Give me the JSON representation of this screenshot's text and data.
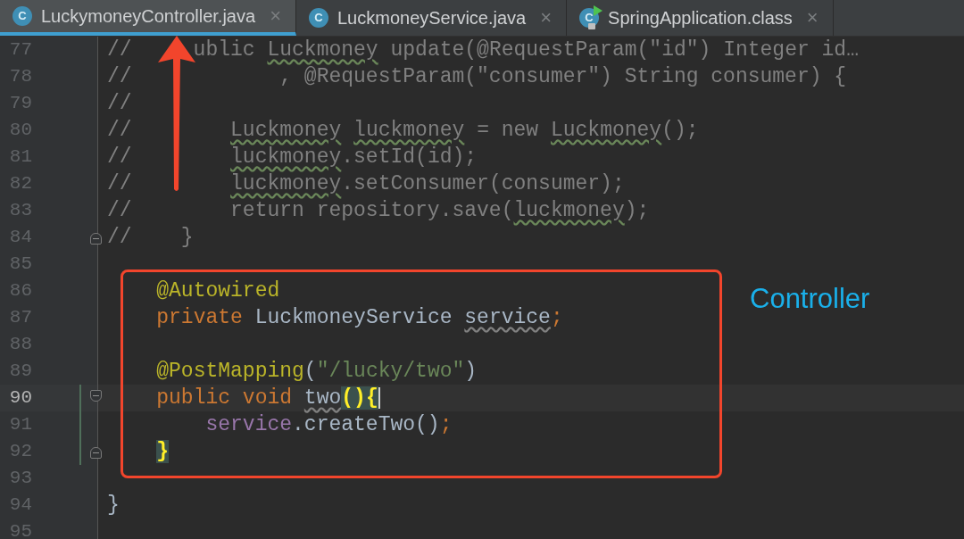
{
  "tabs": [
    {
      "label": "LuckymoneyController.java",
      "icon_letter": "C",
      "kind": "class",
      "selected": true,
      "close": "×"
    },
    {
      "label": "LuckmoneyService.java",
      "icon_letter": "C",
      "kind": "class",
      "selected": false,
      "close": "×"
    },
    {
      "label": "SpringApplication.class",
      "icon_letter": "C",
      "kind": "runnable",
      "selected": false,
      "close": "×"
    }
  ],
  "editor": {
    "lines": [
      {
        "number": "77",
        "current": false,
        "changed": false,
        "fold_start": false,
        "fold_end": false,
        "tokens": [
          {
            "text": "//     ublic ",
            "kind": "comment"
          },
          {
            "text": "Luckmoney",
            "kind": "comment-warn"
          },
          {
            "text": " update(@RequestParam(\"id\") Integer id…",
            "kind": "comment"
          }
        ]
      },
      {
        "number": "78",
        "current": false,
        "changed": false,
        "fold_start": false,
        "fold_end": false,
        "tokens": [
          {
            "text": "//            , @RequestParam(\"consumer\") String consumer) {",
            "kind": "comment"
          }
        ]
      },
      {
        "number": "79",
        "current": false,
        "changed": false,
        "fold_start": false,
        "fold_end": false,
        "tokens": [
          {
            "text": "//",
            "kind": "comment"
          }
        ]
      },
      {
        "number": "80",
        "current": false,
        "changed": false,
        "fold_start": false,
        "fold_end": false,
        "tokens": [
          {
            "text": "//        ",
            "kind": "comment"
          },
          {
            "text": "Luckmoney",
            "kind": "comment-warn"
          },
          {
            "text": " luckmoney",
            "kind": "comment-warn"
          },
          {
            "text": " = new ",
            "kind": "comment"
          },
          {
            "text": "Luckmoney",
            "kind": "comment-warn"
          },
          {
            "text": "();",
            "kind": "comment"
          }
        ]
      },
      {
        "number": "81",
        "current": false,
        "changed": false,
        "fold_start": false,
        "fold_end": false,
        "tokens": [
          {
            "text": "//        ",
            "kind": "comment"
          },
          {
            "text": "luckmoney",
            "kind": "comment-warn"
          },
          {
            "text": ".setId(id);",
            "kind": "comment"
          }
        ]
      },
      {
        "number": "82",
        "current": false,
        "changed": false,
        "fold_start": false,
        "fold_end": false,
        "tokens": [
          {
            "text": "//        ",
            "kind": "comment"
          },
          {
            "text": "luckmoney",
            "kind": "comment-warn"
          },
          {
            "text": ".setConsumer(consumer);",
            "kind": "comment"
          }
        ]
      },
      {
        "number": "83",
        "current": false,
        "changed": false,
        "fold_start": false,
        "fold_end": false,
        "tokens": [
          {
            "text": "//        return repository.save(",
            "kind": "comment"
          },
          {
            "text": "luckmoney",
            "kind": "comment-warn"
          },
          {
            "text": ");",
            "kind": "comment"
          }
        ]
      },
      {
        "number": "84",
        "current": false,
        "changed": false,
        "fold_start": false,
        "fold_end": true,
        "tokens": [
          {
            "text": "//    }",
            "kind": "comment"
          }
        ]
      },
      {
        "number": "85",
        "current": false,
        "changed": false,
        "fold_start": false,
        "fold_end": false
      },
      {
        "number": "86",
        "current": false,
        "changed": false,
        "fold_start": false,
        "fold_end": false,
        "tokens": [
          {
            "text": "    @Autowired",
            "kind": "annotation"
          }
        ]
      },
      {
        "number": "87",
        "current": false,
        "changed": false,
        "fold_start": false,
        "fold_end": false,
        "tokens": [
          {
            "text": "    private",
            "kind": "keyword"
          },
          {
            "text": " LuckmoneyService ",
            "kind": "plain"
          },
          {
            "text": "service",
            "kind": "plain-warn"
          },
          {
            "text": ";",
            "kind": "keyword"
          }
        ]
      },
      {
        "number": "88",
        "current": false,
        "changed": false,
        "fold_start": false,
        "fold_end": false
      },
      {
        "number": "89",
        "current": false,
        "changed": false,
        "fold_start": false,
        "fold_end": false,
        "tokens": [
          {
            "text": "    @PostMapping",
            "kind": "annotation"
          },
          {
            "text": "(",
            "kind": "plain"
          },
          {
            "text": "\"/lucky/two\"",
            "kind": "string"
          },
          {
            "text": ")",
            "kind": "plain"
          }
        ]
      },
      {
        "number": "90",
        "current": true,
        "changed": true,
        "fold_start": true,
        "fold_end": false,
        "tokens": [
          {
            "text": "    public void ",
            "kind": "keyword"
          },
          {
            "text": "two",
            "kind": "plain-warn"
          },
          {
            "text": "(){",
            "kind": "match"
          }
        ]
      },
      {
        "number": "91",
        "current": false,
        "changed": true,
        "fold_start": false,
        "fold_end": false,
        "tokens": [
          {
            "text": "        service",
            "kind": "field"
          },
          {
            "text": ".createTwo()",
            "kind": "plain"
          },
          {
            "text": ";",
            "kind": "keyword"
          }
        ]
      },
      {
        "number": "92",
        "current": false,
        "changed": true,
        "fold_start": false,
        "fold_end": true,
        "tokens": [
          {
            "text": "    }",
            "kind": "match"
          }
        ]
      },
      {
        "number": "93",
        "current": false,
        "changed": false,
        "fold_start": false,
        "fold_end": false
      },
      {
        "number": "94",
        "current": false,
        "changed": false,
        "fold_start": false,
        "fold_end": false,
        "tokens": [
          {
            "text": "}",
            "kind": "plain"
          }
        ]
      },
      {
        "number": "95",
        "current": false,
        "changed": false,
        "fold_start": false,
        "fold_end": false
      }
    ]
  },
  "annotation": {
    "label": "Controller"
  }
}
